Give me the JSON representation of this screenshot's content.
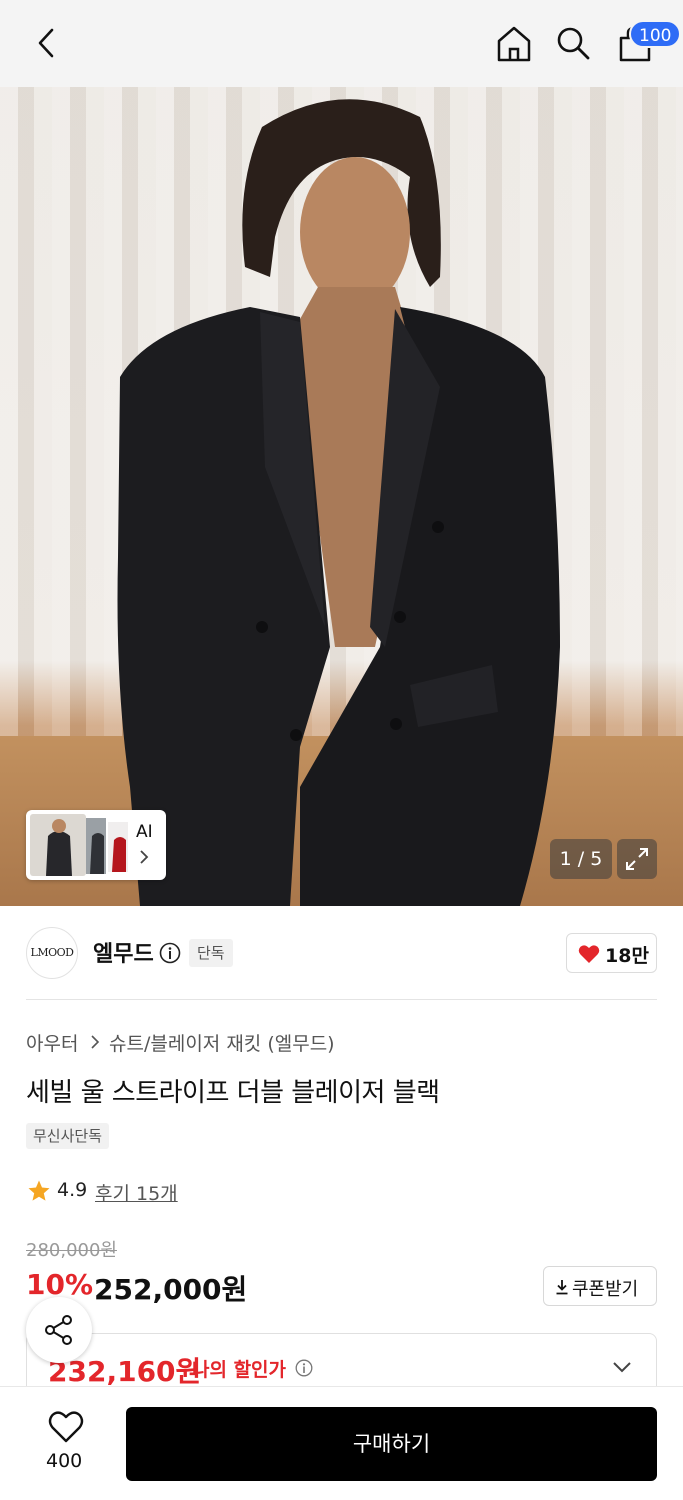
{
  "header": {
    "back_icon": "chevron-left-icon",
    "home_icon": "home-icon",
    "search_icon": "search-icon",
    "cart_icon": "shopping-bag-icon",
    "cart_badge": "100",
    "badge_color": "#2e6cf6"
  },
  "gallery": {
    "ai_label": "AI",
    "counter": "1 / 5",
    "expand_icon": "expand-icon"
  },
  "brand": {
    "logo_text": "LMOOD",
    "name": "엘무드",
    "exclusive_tag": "단독",
    "like_count": "18만"
  },
  "breadcrumb": {
    "category": "아우터",
    "subcategory": "슈트/블레이저 재킷 (엘무드)"
  },
  "product": {
    "title": "세빌 울 스트라이프 더블 블레이저 블랙",
    "tag": "무신사단독",
    "rating": "4.9",
    "reviews": "후기 15개"
  },
  "price": {
    "original": "280,000원",
    "discount_pct": "10%",
    "sale": "252,000원",
    "coupon_label": "쿠폰받기",
    "my_price": "232,160원",
    "my_price_label": "나의 할인가",
    "accent_color": "#e3262b"
  },
  "bottom_bar": {
    "wish_count": "400",
    "buy_label": "구매하기"
  }
}
